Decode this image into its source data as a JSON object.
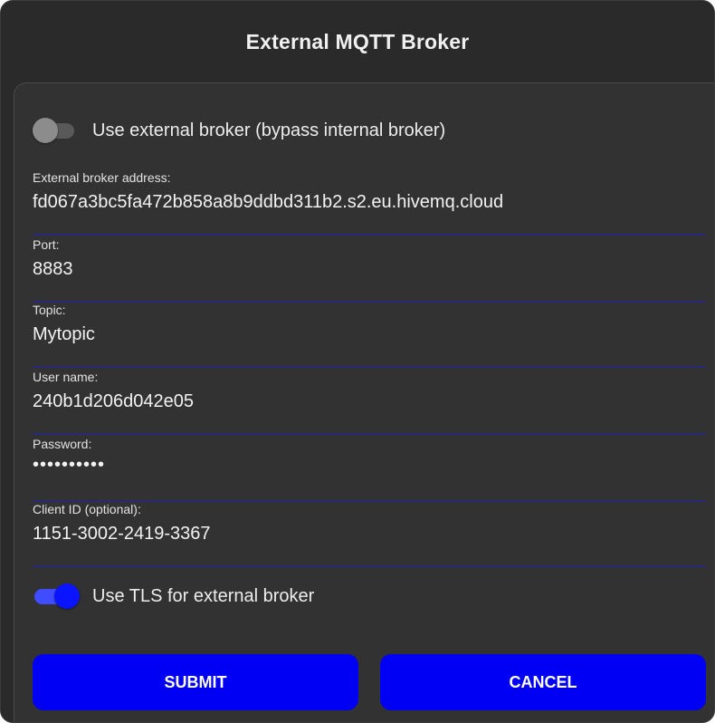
{
  "dialog": {
    "title": "External MQTT Broker"
  },
  "external_broker_toggle": {
    "label": "Use external broker (bypass internal broker)",
    "checked": false
  },
  "fields": {
    "broker_address": {
      "label": "External broker address:",
      "value": "fd067a3bc5fa472b858a8b9ddbd311b2.s2.eu.hivemq.cloud"
    },
    "port": {
      "label": "Port:",
      "value": "8883"
    },
    "topic": {
      "label": "Topic:",
      "value": "Mytopic"
    },
    "username": {
      "label": "User name:",
      "value": "240b1d206d042e05"
    },
    "password": {
      "label": "Password:",
      "value": "••••••••••"
    },
    "client_id": {
      "label": "Client ID (optional):",
      "value": "1151-3002-2419-3367"
    }
  },
  "tls_toggle": {
    "label": "Use TLS for external broker",
    "checked": true
  },
  "buttons": {
    "submit": "SUBMIT",
    "cancel": "CANCEL"
  },
  "colors": {
    "accent": "#0000f5",
    "background": "#2a2a2a",
    "panel": "#323232",
    "underline": "#1f1fbf"
  }
}
